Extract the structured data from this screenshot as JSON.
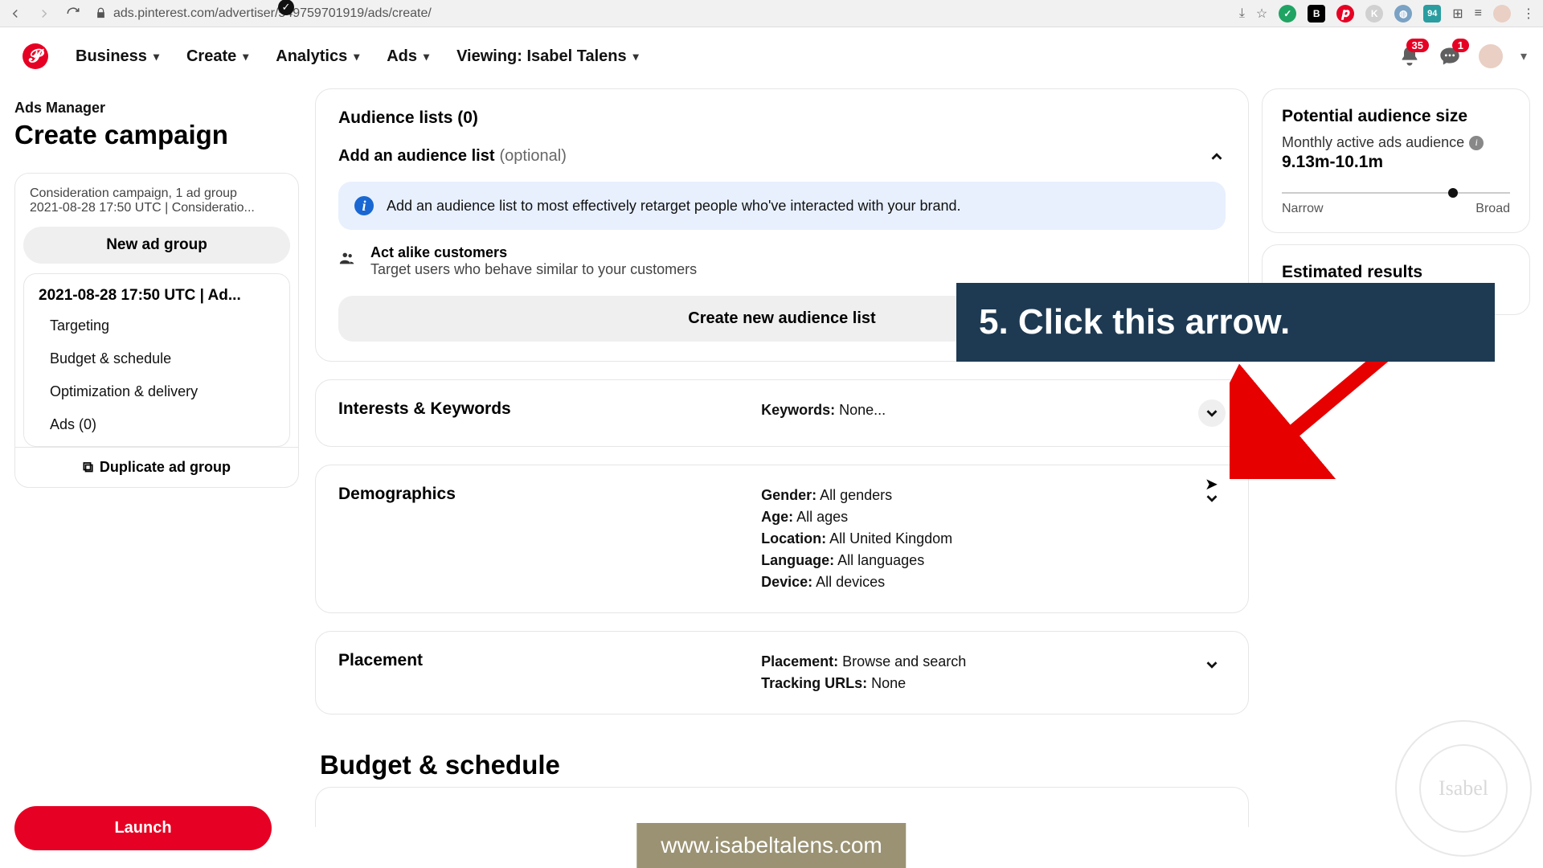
{
  "browser": {
    "url": "ads.pinterest.com/advertiser/549759701919/ads/create/"
  },
  "nav": {
    "business": "Business",
    "create": "Create",
    "analytics": "Analytics",
    "ads": "Ads",
    "viewing": "Viewing: Isabel Talens",
    "notif_count": "35",
    "msg_count": "1"
  },
  "sidebar": {
    "mgr": "Ads Manager",
    "title": "Create campaign",
    "campaign_line1": "Consideration campaign, 1 ad group",
    "campaign_line2": "2021-08-28 17:50 UTC | Consideratio...",
    "new_group": "New ad group",
    "group_title": "2021-08-28 17:50 UTC | Ad...",
    "links": {
      "t": "Targeting",
      "b": "Budget & schedule",
      "o": "Optimization & delivery",
      "a": "Ads (0)"
    },
    "dup": "Duplicate ad group",
    "launch": "Launch"
  },
  "cards": {
    "aud_title": "Audience lists (0)",
    "add_list": "Add an audience list",
    "optional": "(optional)",
    "info": "Add an audience list to most effectively retarget people who've interacted with your brand.",
    "act_t": "Act alike customers",
    "act_d": "Target users who behave similar to your customers",
    "create_btn": "Create new audience list",
    "ik_title": "Interests & Keywords",
    "ik_kw_label": "Keywords:",
    "ik_kw_val": " None...",
    "demo_title": "Demographics",
    "demo": {
      "g_l": "Gender:",
      "g_v": " All genders",
      "a_l": "Age:",
      "a_v": " All ages",
      "lo_l": "Location:",
      "lo_v": " All United Kingdom",
      "la_l": "Language:",
      "la_v": " All languages",
      "d_l": "Device:",
      "d_v": " All devices"
    },
    "pl_title": "Placement",
    "pl": {
      "p_l": "Placement:",
      "p_v": " Browse and search",
      "t_l": "Tracking URLs:",
      "t_v": " None"
    },
    "budget_title": "Budget & schedule"
  },
  "right": {
    "pot_title": "Potential audience size",
    "pot_sub": "Monthly active ads audience",
    "pot_val": "9.13m-10.1m",
    "narrow": "Narrow",
    "broad": "Broad",
    "est_title": "Estimated results"
  },
  "anno": {
    "text": "5. Click this arrow."
  },
  "wm": {
    "url": "www.isabeltalens.com",
    "name": "Isabel"
  }
}
